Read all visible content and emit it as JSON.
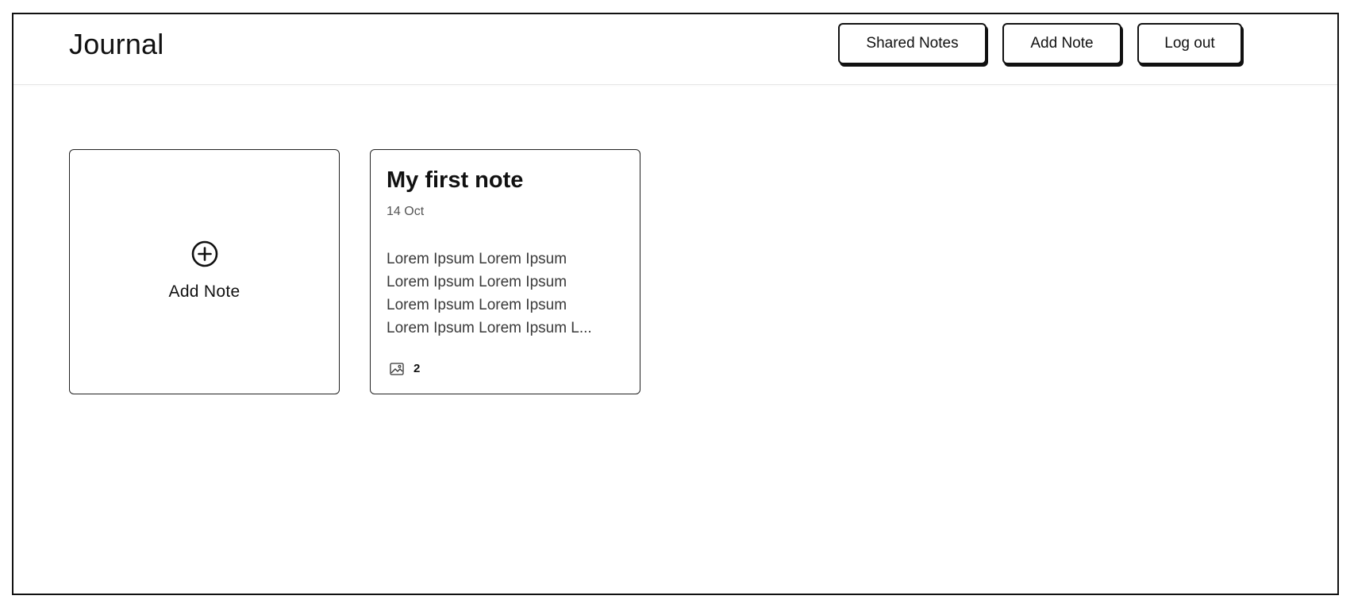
{
  "app": {
    "title": "Journal"
  },
  "nav": {
    "shared_notes": "Shared Notes",
    "add_note": "Add Note",
    "log_out": "Log out"
  },
  "add_card": {
    "label": "Add Note",
    "icon": "plus-circle-icon"
  },
  "notes": [
    {
      "title": "My first note",
      "date": "14 Oct",
      "preview_lines": [
        "Lorem Ipsum Lorem Ipsum",
        "Lorem Ipsum Lorem Ipsum",
        "Lorem Ipsum Lorem Ipsum",
        "Lorem Ipsum Lorem Ipsum L..."
      ],
      "image_count": "2",
      "image_icon": "image-icon"
    }
  ],
  "colors": {
    "border": "#111111",
    "muted_text": "#555555",
    "background": "#ffffff"
  }
}
